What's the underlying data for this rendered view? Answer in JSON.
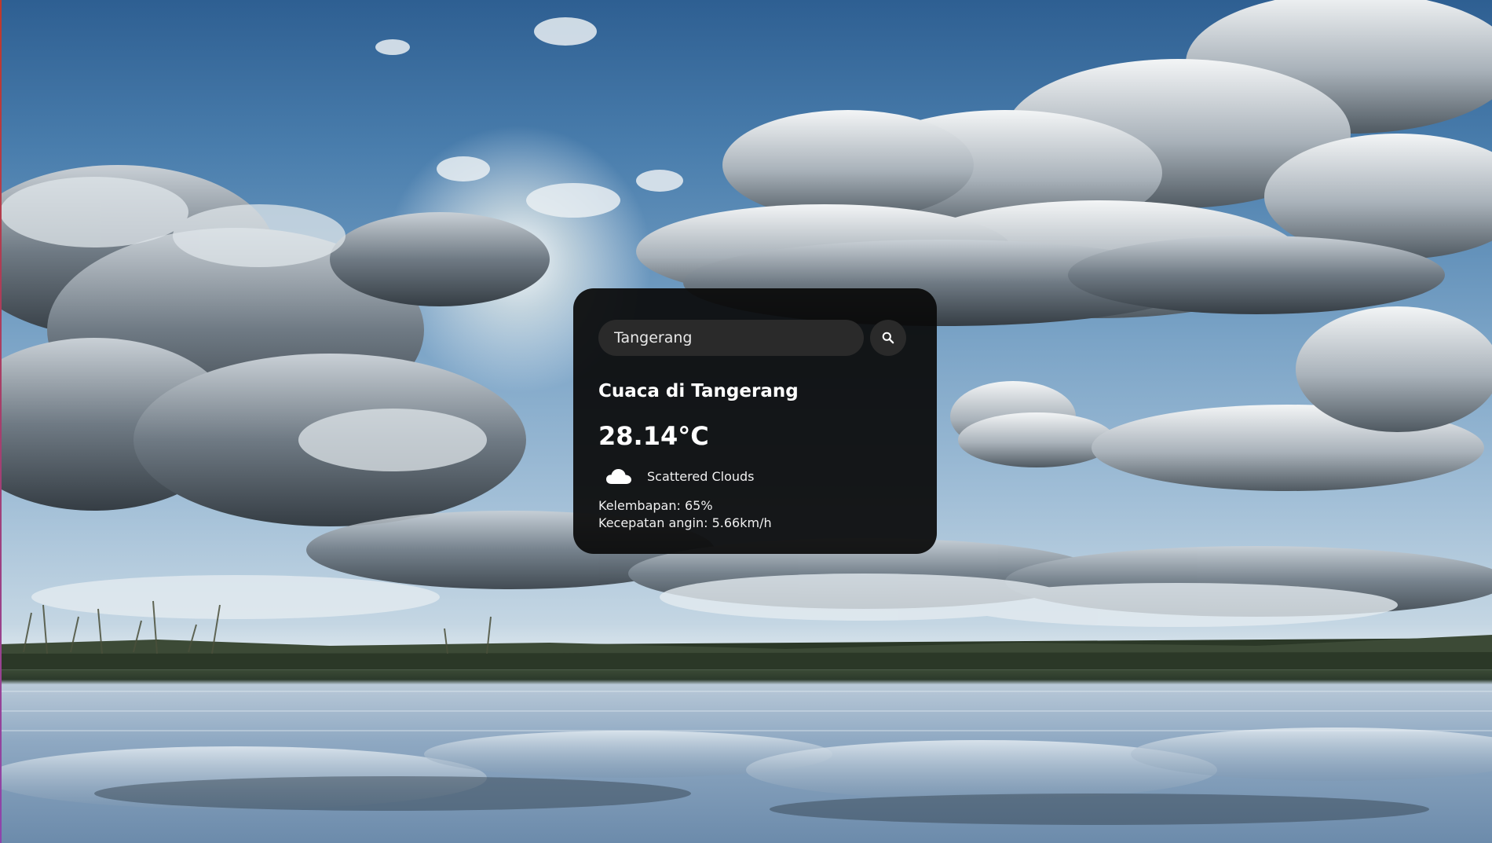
{
  "search": {
    "value": "Tangerang",
    "button_icon": "search-icon"
  },
  "weather": {
    "title": "Cuaca di Tangerang",
    "temperature": "28.14°C",
    "condition_icon": "cloud-icon",
    "condition": "Scattered Clouds",
    "humidity": "Kelembapan: 65%",
    "wind": "Kecepatan angin: 5.66km/h"
  },
  "background": {
    "description_icon": "lake-sky-photo"
  },
  "colors": {
    "card_bg": "#0a0a0a",
    "input_bg": "#2a2a2a",
    "text": "#ffffff"
  }
}
